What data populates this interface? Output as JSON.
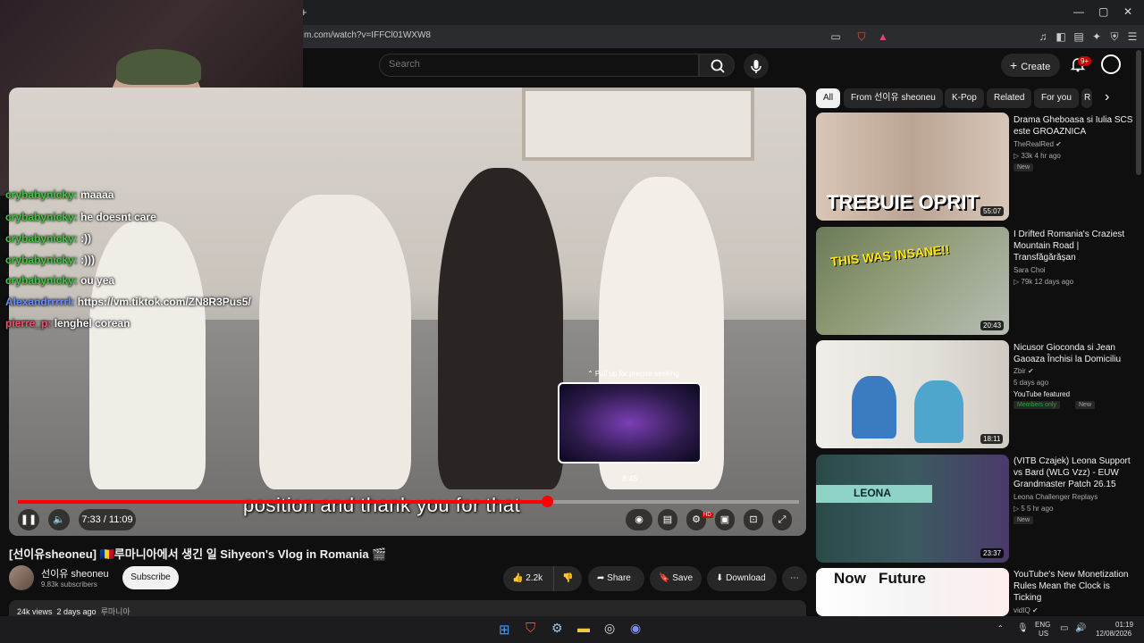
{
  "browser": {
    "url": "m.com/watch?v=IFFCl01WXW8",
    "new_tab": "+"
  },
  "header": {
    "search_placeholder": "Search",
    "create_label": "Create",
    "notif_count": "9+"
  },
  "chat": [
    {
      "user": "crybabynicky:",
      "msg": "maaaa"
    },
    {
      "user": "crybabynicky:",
      "msg": "he doesnt care"
    },
    {
      "user": "crybabynicky:",
      "msg": ":))"
    },
    {
      "user": "crybabynicky:",
      "msg": ":)))"
    },
    {
      "user": "crybabynicky:",
      "msg": "ou yea"
    },
    {
      "user": "Alexandrrrrrl:",
      "msg": "https://vm.tiktok.com/ZN8R3Pus5/"
    },
    {
      "user": "pierre_p:",
      "msg": "lenghel corean"
    }
  ],
  "player": {
    "subtitle": "position and thank you for that",
    "seek_hint": "⌃ Pull up for precise seeking",
    "preview_time": "8:45",
    "time": "7:33 / 11:09",
    "progress": 0.677,
    "hd_badge": "HD"
  },
  "video": {
    "title": "[선이유sheoneu] 🇷🇴루마니아에서 생긴 일 Sihyeon's Vlog in Romania 🎬",
    "channel": "선이유 sheoneu",
    "subs": "9.83k subscribers",
    "subscribe": "Subscribe",
    "likes": "2.2k",
    "share": "Share",
    "save": "Save",
    "download": "Download",
    "views": "24k views",
    "age": "2 days ago",
    "tag": "루마니아"
  },
  "chips": [
    "All",
    "From 선이유 sheoneu",
    "K-Pop",
    "Related",
    "For you",
    "R"
  ],
  "recommendations": [
    {
      "title": "Drama Gheboasa si Iulia SCS este GROAZNICA",
      "channel": "TheRealRed ✔",
      "meta": "▷ 33k  4 hr ago",
      "badge": "New",
      "duration": "55:07",
      "thumb_text": "TREBUIE OPRIT"
    },
    {
      "title": "I Drifted Romania's Craziest Mountain Road | Transfăgărășan",
      "channel": "Sara Choi",
      "meta": "▷ 79k  12 days ago",
      "badge": "",
      "duration": "20:43",
      "thumb_text": "THIS WAS INSANE!!"
    },
    {
      "title": "Nicusor Gioconda si Jean Gaoaza Închisi la Domiciliu",
      "channel": "Zbir ✔",
      "meta": "5 days ago",
      "featured": "YouTube featured",
      "members": "Members only",
      "badge": "New",
      "duration": "18:11",
      "thumb_text": ""
    },
    {
      "title": "(VITB Czajek) Leona Support vs Bard (WLG Vzz) - EUW Grandmaster Patch 26.15",
      "channel": "Leona Challenger Replays",
      "meta": "▷ 5  5 hr ago",
      "badge": "New",
      "duration": "23:37",
      "thumb_text": "LEONA"
    },
    {
      "title": "YouTube's New Monetization Rules Mean the Clock is Ticking",
      "channel": "vidIQ ✔",
      "meta": "",
      "badge": "",
      "duration": "",
      "thumb_text": "Now   Future"
    }
  ],
  "taskbar": {
    "lang": "ENG",
    "region": "US",
    "time": "01:19",
    "date": "12/08/2026"
  },
  "colors": {
    "accent": "#ff0000",
    "chat_user": "#3ec93e"
  }
}
